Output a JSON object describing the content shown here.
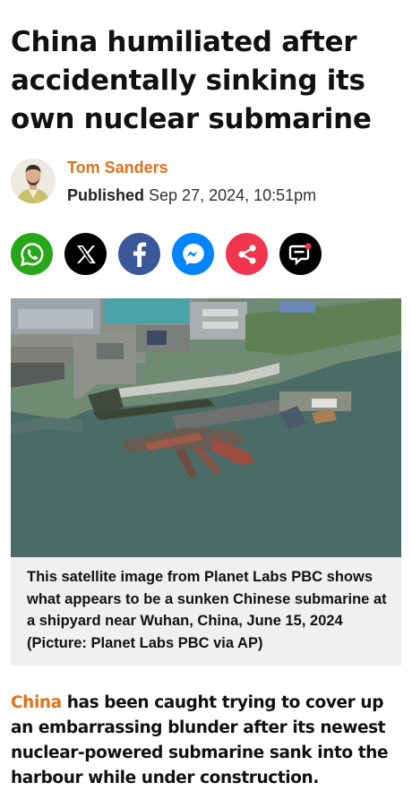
{
  "article": {
    "headline": "China humiliated after accidentally sinking its own nuclear submarine",
    "author": "Tom Sanders",
    "published_label": "Published",
    "published_date": "Sep 27, 2024, 10:51pm"
  },
  "share": [
    {
      "name": "whatsapp",
      "icon": "whatsapp-icon",
      "color": "#29a71a"
    },
    {
      "name": "x",
      "icon": "x-icon",
      "color": "#000000"
    },
    {
      "name": "facebook",
      "icon": "facebook-icon",
      "color": "#3b5998"
    },
    {
      "name": "messenger",
      "icon": "messenger-icon",
      "color": "#0084ff"
    },
    {
      "name": "share",
      "icon": "share-icon",
      "color": "#f0364f"
    },
    {
      "name": "comments",
      "icon": "comment-icon",
      "color": "#000000"
    }
  ],
  "image": {
    "caption": "This satellite image from Planet Labs PBC shows what appears to be a sunken Chinese submarine at a shipyard near Wuhan, China, June 15, 2024 (Picture: Planet Labs PBC via AP)"
  },
  "body": {
    "link_text": "China",
    "text": " has been caught trying to cover up an embarrassing blunder after its newest nuclear-powered submarine sank into the harbour while under construction."
  },
  "colors": {
    "accent": "#e0701a",
    "caption_bg": "#f0f0f0"
  }
}
